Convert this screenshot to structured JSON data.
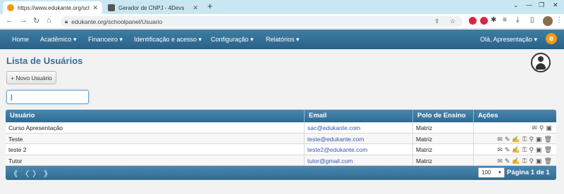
{
  "browser": {
    "tabs": [
      {
        "title": "https://www.edukante.org/schoo"
      },
      {
        "title": "Gerador de CNPJ - 4Devs"
      }
    ],
    "url": "edukante.org/schoolpanel/Usuario"
  },
  "nav": {
    "items": [
      "Home",
      "Acadêmico ▾",
      "Financeiro ▾",
      "Identificação e acesso ▾",
      "Configuração ▾",
      "Relatórios ▾"
    ],
    "greeting": "Olá, Apresentação ▾"
  },
  "page": {
    "title": "Lista de Usuários",
    "new_user_label": "+ Novo Usuário",
    "search_value": "|"
  },
  "grid": {
    "headers": [
      "Usuário",
      "Email",
      "Polo de Ensino",
      "Ações"
    ],
    "rows": [
      {
        "user": "Curso Apresentação",
        "email": "sac@edukante.com",
        "polo": "Matriz"
      },
      {
        "user": "Teste",
        "email": "teste@edukante.com",
        "polo": "Matriz"
      },
      {
        "user": "teste 2",
        "email": "teste2@edukante.com",
        "polo": "Matriz"
      },
      {
        "user": "Tutor",
        "email": "tutor@gmail.com",
        "polo": "Matriz"
      }
    ],
    "pager": "《 〈 〉 》",
    "page_size": "100",
    "page_info": "Página 1 de 1"
  }
}
